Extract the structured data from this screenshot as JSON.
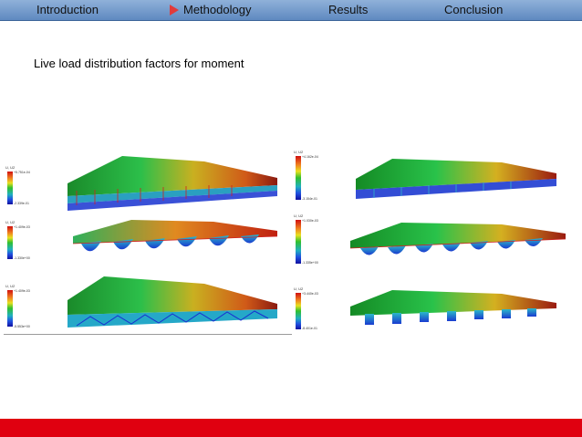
{
  "nav": {
    "items": [
      {
        "label": "Introduction"
      },
      {
        "label": "Methodology"
      },
      {
        "label": "Results"
      },
      {
        "label": "Conclusion"
      }
    ],
    "active_marker_color": "#e23b3b"
  },
  "slide": {
    "heading": "Live load distribution factors for moment",
    "figures": {
      "left": [
        {
          "legend_title": "U, U2",
          "legend_top": "+5.751e-04",
          "legend_bottom": "-2.339e-01"
        },
        {
          "legend_title": "U, U2",
          "legend_top": "+1.409e-03",
          "legend_bottom": "-1.330e+00"
        },
        {
          "legend_title": "U, U2",
          "legend_top": "+1.409e-03",
          "legend_bottom": "-5.553e+00"
        }
      ],
      "right": [
        {
          "legend_title": "U, U2",
          "legend_top": "+4.162e-04",
          "legend_bottom": "-3.154e-01"
        },
        {
          "legend_title": "U, U2",
          "legend_top": "+1.030e-03",
          "legend_bottom": "-1.335e+00"
        },
        {
          "legend_title": "U, U2",
          "legend_top": "+3.440e-03",
          "legend_bottom": "-8.401e-01"
        }
      ]
    }
  },
  "colors": {
    "nav_bg": "#6f97c9",
    "bottom_bar": "#e00010"
  }
}
